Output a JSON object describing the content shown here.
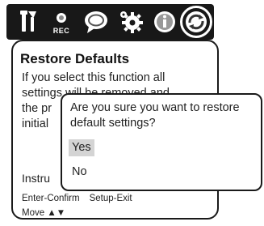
{
  "tabbar": {
    "tabs": [
      {
        "icon": "tools-icon",
        "label": ""
      },
      {
        "icon": "record-icon",
        "label": "REC"
      },
      {
        "icon": "speech-bubble-icon",
        "label": ""
      },
      {
        "icon": "gear-icon",
        "label": ""
      },
      {
        "icon": "info-icon",
        "label": ""
      },
      {
        "icon": "restore-icon",
        "label": ""
      }
    ],
    "selected_index": 5
  },
  "panel": {
    "title": "Restore Defaults",
    "description_lines": [
      "If you select this function all",
      "settings will be removed and",
      "the pr",
      "initial"
    ],
    "instructions_heading": "Instru",
    "instructions": {
      "confirm": "Enter-Confirm",
      "exit": "Setup-Exit",
      "move": "Move ▲▼"
    }
  },
  "dialog": {
    "message_lines": [
      "Are you sure you want to restore",
      "default settings?"
    ],
    "options": [
      {
        "label": "Yes",
        "highlighted": true
      },
      {
        "label": "No",
        "highlighted": false
      }
    ]
  },
  "colors": {
    "tabbar_bg": "#181818",
    "icon_fg": "#ffffff",
    "panel_border": "#1a1a1a",
    "highlight": "#d4d4d4"
  }
}
